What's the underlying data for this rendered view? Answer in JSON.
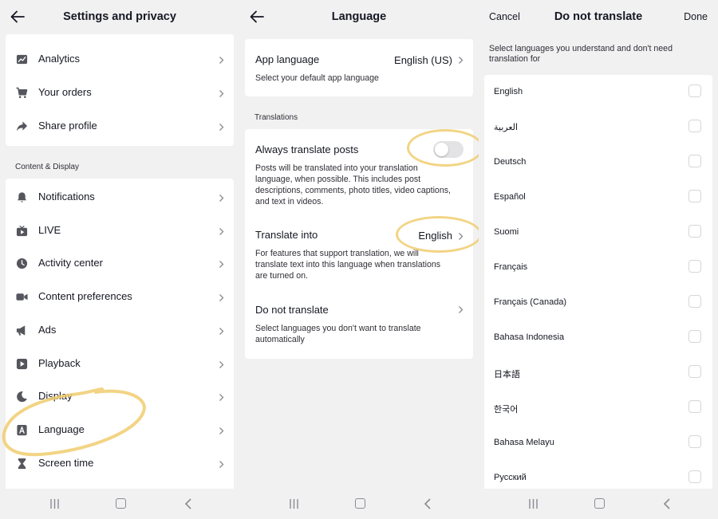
{
  "settings": {
    "title": "Settings and privacy",
    "group1": [
      {
        "label": "Analytics",
        "icon": "analytics-icon"
      },
      {
        "label": "Your orders",
        "icon": "cart-icon"
      },
      {
        "label": "Share profile",
        "icon": "share-icon"
      }
    ],
    "section_label": "Content & Display",
    "group2": [
      {
        "label": "Notifications",
        "icon": "bell-icon"
      },
      {
        "label": "LIVE",
        "icon": "live-tv-icon"
      },
      {
        "label": "Activity center",
        "icon": "clock-icon"
      },
      {
        "label": "Content preferences",
        "icon": "video-camera-icon"
      },
      {
        "label": "Ads",
        "icon": "megaphone-icon"
      },
      {
        "label": "Playback",
        "icon": "play-icon"
      },
      {
        "label": "Display",
        "icon": "moon-icon"
      },
      {
        "label": "Language",
        "icon": "language-icon"
      },
      {
        "label": "Screen time",
        "icon": "hourglass-icon"
      }
    ]
  },
  "language": {
    "title": "Language",
    "app_language": {
      "label": "App language",
      "value": "English (US)",
      "description": "Select your default app language"
    },
    "translations_label": "Translations",
    "always_translate": {
      "label": "Always translate posts",
      "enabled": false,
      "description": "Posts will be translated into your translation language, when possible. This includes post descriptions, comments, photo titles, video captions, and text in videos."
    },
    "translate_into": {
      "label": "Translate into",
      "value": "English",
      "description": "For features that support translation, we will translate text into this language when translations are turned on."
    },
    "do_not_translate": {
      "label": "Do not translate",
      "description": "Select languages you don't want to translate automatically"
    }
  },
  "do_not_translate": {
    "cancel_label": "Cancel",
    "title": "Do not translate",
    "done_label": "Done",
    "instruction": "Select languages you understand and don't need translation for",
    "languages": [
      {
        "label": "English",
        "checked": false
      },
      {
        "label": "العربية",
        "checked": false
      },
      {
        "label": "Deutsch",
        "checked": false
      },
      {
        "label": "Español",
        "checked": false
      },
      {
        "label": "Suomi",
        "checked": false
      },
      {
        "label": "Français",
        "checked": false
      },
      {
        "label": "Français (Canada)",
        "checked": false
      },
      {
        "label": "Bahasa Indonesia",
        "checked": false
      },
      {
        "label": "日本語",
        "checked": false
      },
      {
        "label": "한국어",
        "checked": false
      },
      {
        "label": "Bahasa Melayu",
        "checked": false
      },
      {
        "label": "Русский",
        "checked": false
      }
    ]
  },
  "colors": {
    "background": "#f1f1f2",
    "card": "#ffffff",
    "text": "#161823",
    "highlight": "#f0cd6e",
    "toggle_off": "#e3e3e6"
  }
}
